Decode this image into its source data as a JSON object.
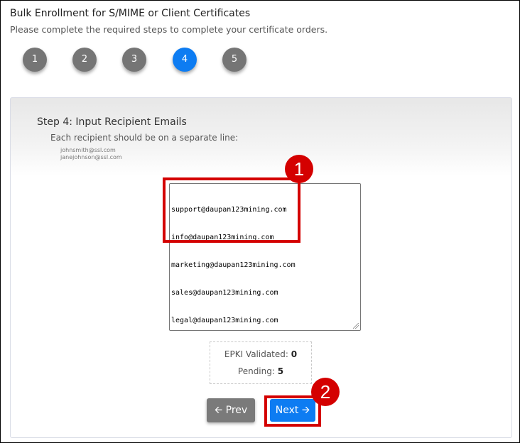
{
  "header": {
    "title": "Bulk Enrollment for S/MIME or Client Certificates",
    "subtitle": "Please complete the required steps to complete your certificate orders."
  },
  "stepper": {
    "steps": [
      "1",
      "2",
      "3",
      "4",
      "5"
    ],
    "active_step": "4"
  },
  "step": {
    "heading": "Step 4: Input Recipient Emails",
    "instructions": "Each recipient should be on a separate line:",
    "examples": [
      "johnsmith@ssl.com",
      "janejohnson@ssl.com"
    ]
  },
  "recipients_textarea": {
    "lines": [
      "support@daupan123mining.com",
      "info@daupan123mining.com",
      "marketing@daupan123mining.com",
      "sales@daupan123mining.com",
      "legal@daupan123mining.com"
    ]
  },
  "counts": {
    "validated_label": "EPKI Validated:",
    "validated_value": "0",
    "pending_label": "Pending:",
    "pending_value": "5"
  },
  "buttons": {
    "prev_label": "Prev",
    "prev_icon": "arrow-left-icon",
    "next_label": "Next",
    "next_icon": "arrow-right-icon"
  },
  "annotations": {
    "marker_1": "1",
    "marker_2": "2",
    "color": "#d40000"
  },
  "colors": {
    "active_step": "#0d7cf2",
    "inactive_step": "#757575",
    "next_button": "#0d7cf2",
    "prev_button": "#7a7a7a"
  }
}
